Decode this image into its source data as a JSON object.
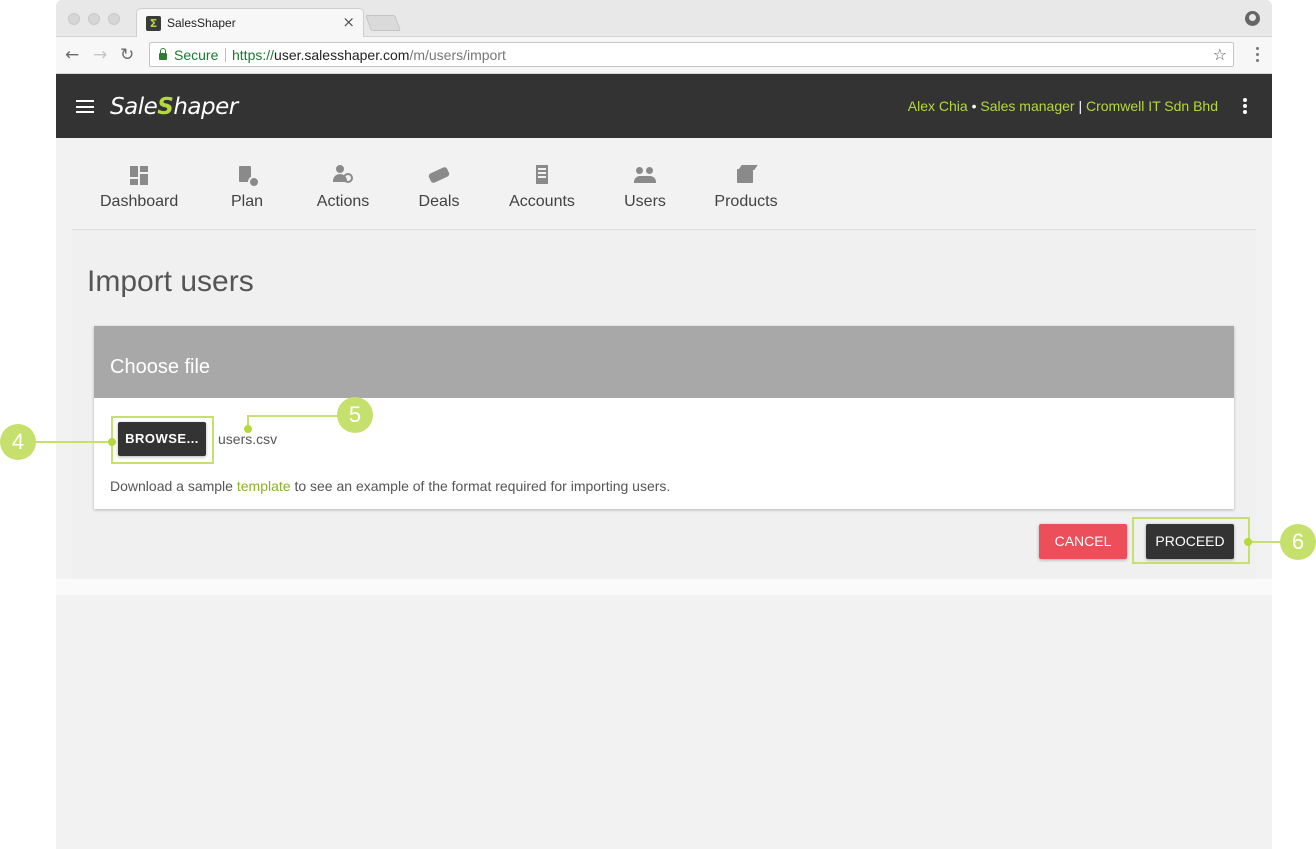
{
  "browser": {
    "tab_title": "SalesShaper",
    "tab_close": "×",
    "favicon_letter": "Σ",
    "secure_label": "Secure",
    "url_scheme": "https://",
    "url_host": "user.salesshaper.com",
    "url_path": "/m/users/import",
    "back": "←",
    "forward": "→",
    "reload": "↻",
    "star": "☆"
  },
  "header": {
    "logo_part1": "Sale",
    "logo_part2": "S",
    "logo_part3": "haper",
    "user_name": "Alex Chia",
    "bullet": "•",
    "role": "Sales manager",
    "divider": "|",
    "company": "Cromwell IT Sdn Bhd"
  },
  "nav": {
    "items": [
      {
        "label": "Dashboard",
        "icon": "dashboard-icon"
      },
      {
        "label": "Plan",
        "icon": "plan-icon"
      },
      {
        "label": "Actions",
        "icon": "actions-icon"
      },
      {
        "label": "Deals",
        "icon": "handshake-icon"
      },
      {
        "label": "Accounts",
        "icon": "building-icon"
      },
      {
        "label": "Users",
        "icon": "users-icon"
      },
      {
        "label": "Products",
        "icon": "box-icon"
      }
    ]
  },
  "main": {
    "title": "Import users",
    "card_title": "Choose file",
    "browse_label": "BROWSE...",
    "file_name": "users.csv",
    "help_prefix": "Download a sample ",
    "help_link": "template",
    "help_suffix": " to see an example of the format required for importing users.",
    "cancel_label": "CANCEL",
    "proceed_label": "PROCEED"
  },
  "callouts": {
    "browse": "4",
    "file": "5",
    "proceed": "6"
  },
  "colors": {
    "accent": "#b5d93a",
    "header_bg": "#333333",
    "cancel": "#ec4f5a",
    "card_header": "#a8a8a8"
  }
}
